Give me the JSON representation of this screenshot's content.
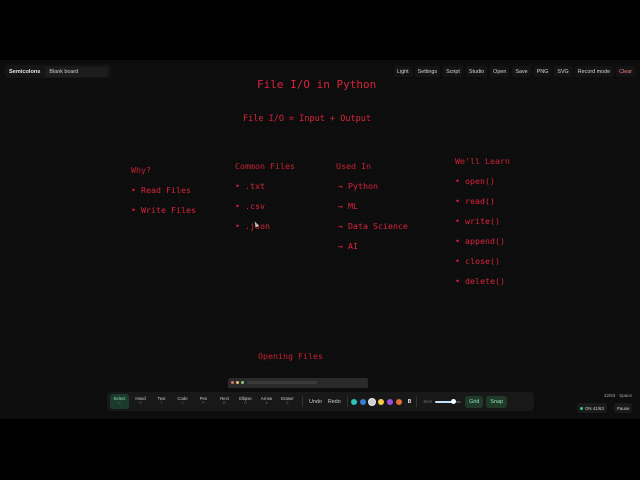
{
  "app": {
    "brand": "Semicolons",
    "board_name": "Blank board"
  },
  "menu": [
    {
      "label": "Light",
      "name": "light-button"
    },
    {
      "label": "Settings",
      "name": "settings-button"
    },
    {
      "label": "Script",
      "name": "script-button"
    },
    {
      "label": "Studio",
      "name": "studio-button"
    },
    {
      "label": "Open",
      "name": "open-button"
    },
    {
      "label": "Save",
      "name": "save-button"
    },
    {
      "label": "PNG",
      "name": "png-button"
    },
    {
      "label": "SVG",
      "name": "svg-button"
    },
    {
      "label": "Record mode",
      "name": "record-mode-button"
    },
    {
      "label": "Clear",
      "name": "clear-button",
      "color": "#f08080"
    }
  ],
  "canvas": {
    "title": "File I/O in Python",
    "subtitle": "File I/O = Input + Output",
    "columns": {
      "why": {
        "heading": "Why?",
        "items": [
          "• Read Files",
          "• Write Files"
        ]
      },
      "common": {
        "heading": "Common Files",
        "items": [
          "• .txt",
          "• .csv",
          "• .json"
        ]
      },
      "used": {
        "heading": "Used In",
        "items": [
          "→ Python",
          "→ ML",
          "→ Data Science",
          "→ AI"
        ]
      },
      "learn": {
        "heading": "We'll Learn",
        "items": [
          "• open()",
          "• read()",
          "• write()",
          "• append()",
          "• close()",
          "• delete()"
        ]
      }
    },
    "footer_heading": "Opening Files",
    "ink_color": "#d9243a"
  },
  "tools": [
    {
      "label": "Select",
      "key": "V",
      "active": true
    },
    {
      "label": "Hand",
      "key": "H"
    },
    {
      "label": "Text",
      "key": "T"
    },
    {
      "label": "Code",
      "key": "C"
    },
    {
      "label": "Pen",
      "key": "P"
    },
    {
      "label": "Rect",
      "key": "R"
    },
    {
      "label": "Ellipse",
      "key": "O"
    },
    {
      "label": "Arrow",
      "key": "A"
    },
    {
      "label": "Eraser",
      "key": "E"
    }
  ],
  "actions": {
    "undo": "Undo",
    "redo": "Redo"
  },
  "swatches": [
    "#2ec4b6",
    "#3a7bd5",
    "#d0d0d0",
    "#f2c94c",
    "#9b51e0",
    "#eb6b34"
  ],
  "stroke": {
    "bold_label": "B",
    "size_label": "Size",
    "size_fraction": 0.7
  },
  "toggles": {
    "grid": "Grid",
    "snap": "Snap"
  },
  "status": {
    "page_count": "42/63 · Space",
    "live": "ON 41/63",
    "pause": "Pause"
  }
}
